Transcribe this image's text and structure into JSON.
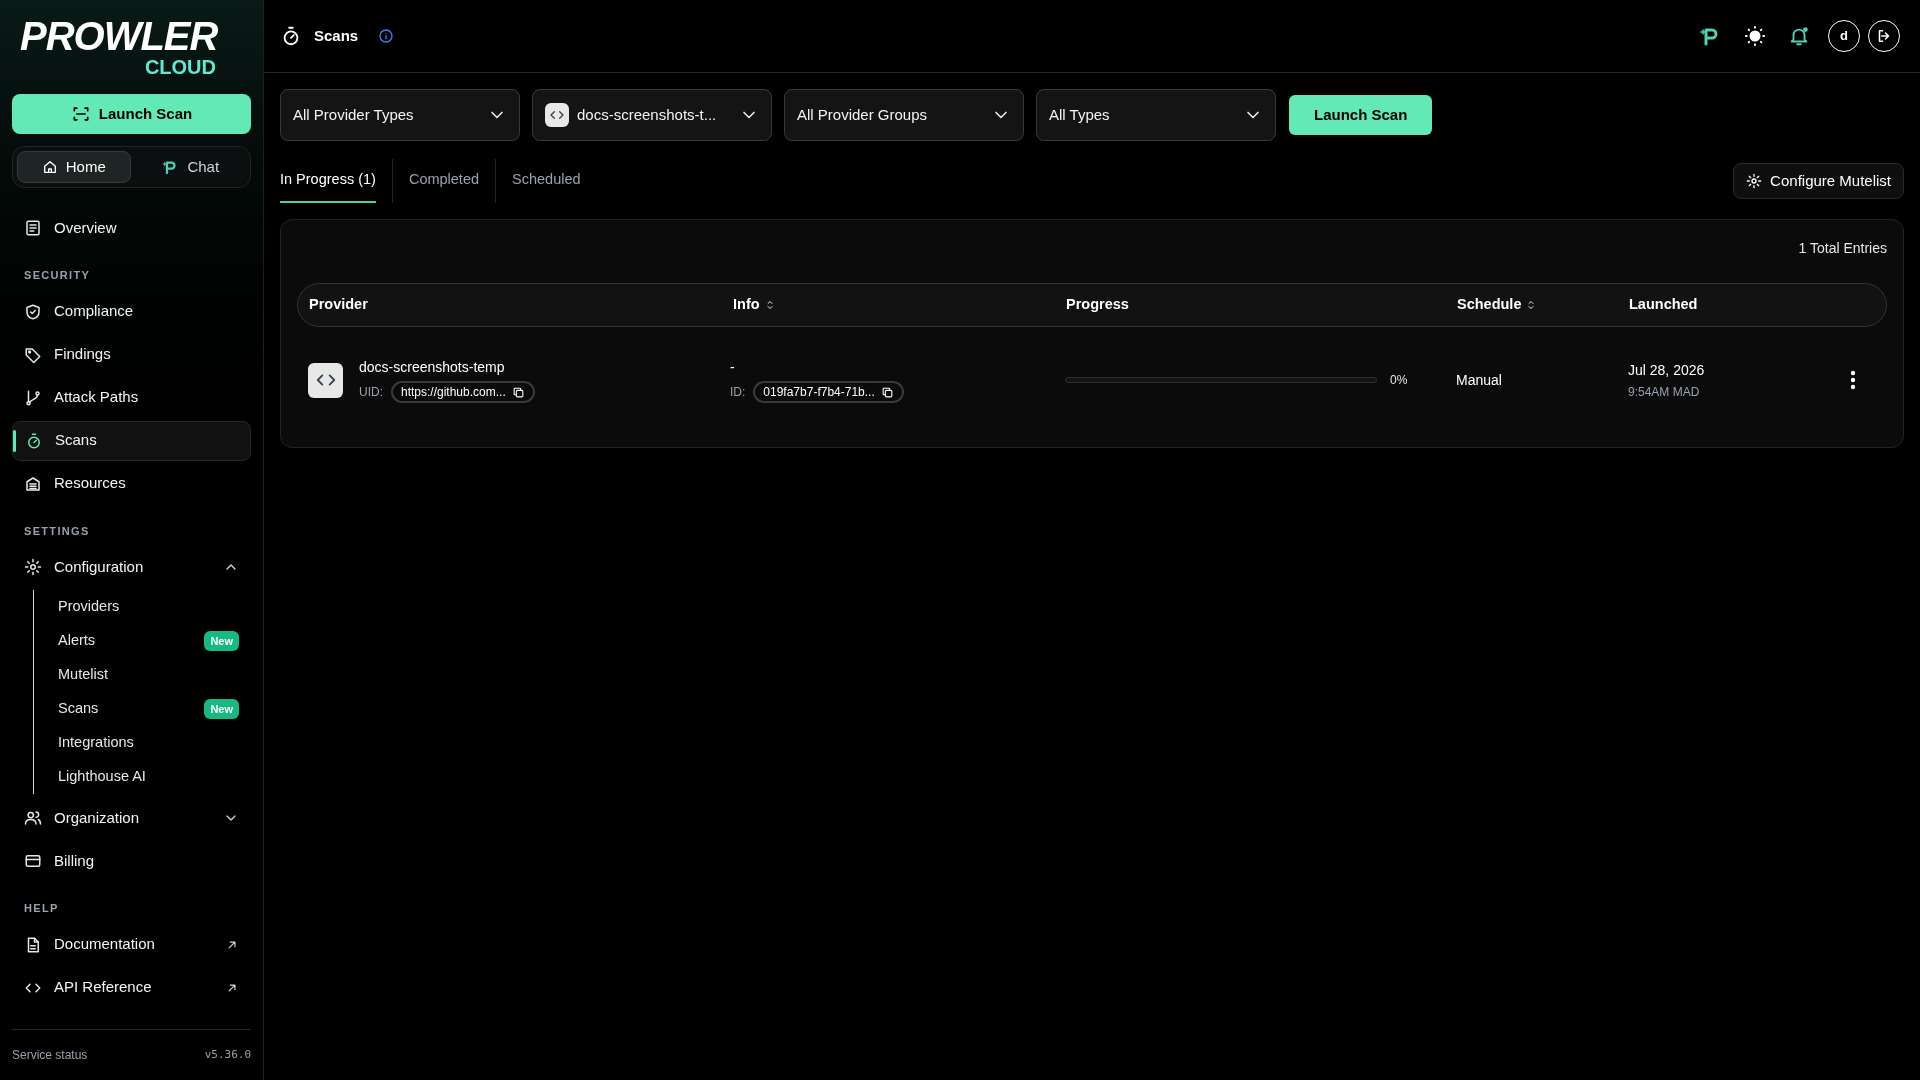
{
  "logo": {
    "name": "PROWLER",
    "sub": "CLOUD"
  },
  "sidebar": {
    "launch_button": "Launch Scan",
    "switch": [
      {
        "label": "Home",
        "selected": true
      },
      {
        "label": "Chat",
        "selected": false
      }
    ],
    "items": [
      {
        "kind": "link",
        "label": "Overview",
        "selected": false
      },
      {
        "kind": "heading",
        "label": "SECURITY"
      },
      {
        "kind": "link",
        "label": "Compliance",
        "selected": false
      },
      {
        "kind": "link",
        "label": "Findings",
        "selected": false
      },
      {
        "kind": "link",
        "label": "Attack Paths",
        "selected": false
      },
      {
        "kind": "link",
        "label": "Scans",
        "selected": true
      },
      {
        "kind": "link",
        "label": "Resources",
        "selected": false
      },
      {
        "kind": "heading",
        "label": "SETTINGS"
      },
      {
        "kind": "group",
        "label": "Configuration",
        "expanded": true,
        "children": [
          {
            "label": "Providers"
          },
          {
            "label": "Alerts",
            "badge": "New"
          },
          {
            "label": "Mutelist"
          },
          {
            "label": "Scans",
            "badge": "New"
          },
          {
            "label": "Integrations"
          },
          {
            "label": "Lighthouse AI"
          }
        ]
      },
      {
        "kind": "group",
        "label": "Organization",
        "expanded": false
      },
      {
        "kind": "link",
        "label": "Billing",
        "selected": false
      },
      {
        "kind": "heading",
        "label": "HELP"
      },
      {
        "kind": "external",
        "label": "Documentation"
      },
      {
        "kind": "external",
        "label": "API Reference"
      }
    ],
    "footer": {
      "status": "Service status",
      "version": "v5.36.0"
    }
  },
  "header": {
    "title": "Scans",
    "avatar": "d"
  },
  "filters": [
    {
      "kind": "select",
      "label": "All Provider Types"
    },
    {
      "kind": "provider",
      "label": "docs-screenshots-t..."
    },
    {
      "kind": "select",
      "label": "All Provider Groups"
    },
    {
      "kind": "select",
      "label": "All Types"
    }
  ],
  "launch_button": "Launch Scan",
  "tabs": [
    {
      "label": "In Progress (1)",
      "selected": true
    },
    {
      "label": "Completed",
      "selected": false
    },
    {
      "label": "Scheduled",
      "selected": false
    }
  ],
  "mutelist_button": "Configure Mutelist",
  "table": {
    "total": "1 Total Entries",
    "columns": [
      {
        "label": "Provider",
        "sortable": false
      },
      {
        "label": "Info",
        "sortable": true
      },
      {
        "label": "Progress",
        "sortable": false
      },
      {
        "label": "Schedule",
        "sortable": true
      },
      {
        "label": "Launched",
        "sortable": false
      }
    ],
    "rows": [
      {
        "provider": "docs-screenshots-temp",
        "uid_label": "UID:",
        "uid": "https://github.com...",
        "info": "-",
        "id_label": "ID:",
        "id": "019fa7b7-f7b4-71b...",
        "level": 0,
        "reading": "0%",
        "schedule": "Manual",
        "date": "Jul 28, 2026",
        "time": "9:54AM MAD"
      }
    ]
  }
}
